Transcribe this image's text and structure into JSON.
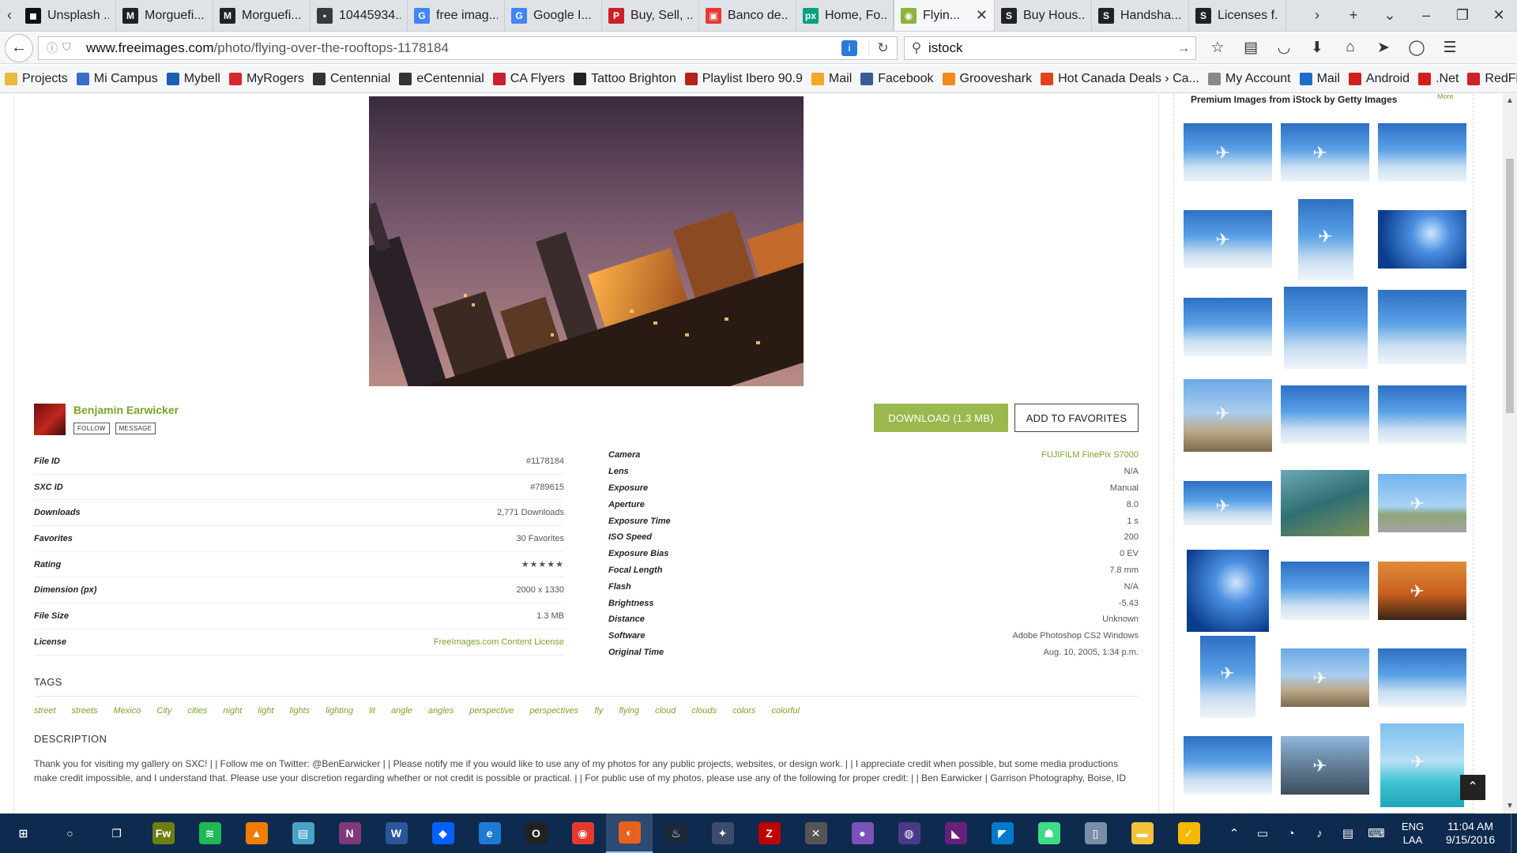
{
  "tabs": [
    {
      "label": "Unsplash ...",
      "icon": "unsplash-icon",
      "color": "#111111",
      "glyph": "◼"
    },
    {
      "label": "Morguefi...",
      "icon": "morguefile-icon",
      "color": "#222222",
      "glyph": "M"
    },
    {
      "label": "Morguefi...",
      "icon": "morguefile-icon",
      "color": "#222222",
      "glyph": "M"
    },
    {
      "label": "10445934...",
      "icon": "photo-icon",
      "color": "#3a3a3a",
      "glyph": "▪"
    },
    {
      "label": "free imag...",
      "icon": "google-icon",
      "color": "#4285f4",
      "glyph": "G"
    },
    {
      "label": "Google I...",
      "icon": "google-icon",
      "color": "#4285f4",
      "glyph": "G"
    },
    {
      "label": "Buy, Sell, ...",
      "icon": "pinterest-icon",
      "color": "#cb2027",
      "glyph": "P"
    },
    {
      "label": "Banco de...",
      "icon": "banco-icon",
      "color": "#e53935",
      "glyph": "▣"
    },
    {
      "label": "Home, Fo...",
      "icon": "pexels-icon",
      "color": "#05a081",
      "glyph": "px"
    },
    {
      "label": "Flyin...",
      "icon": "freeimages-icon",
      "color": "#8cb33e",
      "glyph": "◉",
      "active": true
    },
    {
      "label": "Buy Hous...",
      "icon": "istock-icon",
      "color": "#222222",
      "glyph": "S"
    },
    {
      "label": "Handsha...",
      "icon": "istock-icon",
      "color": "#222222",
      "glyph": "S"
    },
    {
      "label": "Licenses f...",
      "icon": "istock-icon",
      "color": "#222222",
      "glyph": "S"
    }
  ],
  "address": {
    "url_prefix": "www.freeimages.com",
    "url_path": "/photo/flying-over-the-rooftops-1178184"
  },
  "search": {
    "value": "istock"
  },
  "bookmarks": [
    {
      "label": "Projects",
      "color": "#e8b93a"
    },
    {
      "label": "Mi Campus",
      "color": "#3b6cc9"
    },
    {
      "label": "Mybell",
      "color": "#1a5fb4"
    },
    {
      "label": "MyRogers",
      "color": "#d7262b"
    },
    {
      "label": "Centennial",
      "color": "#333333"
    },
    {
      "label": "eCentennial",
      "color": "#333333"
    },
    {
      "label": "CA Flyers",
      "color": "#c8202d"
    },
    {
      "label": "Tattoo Brighton",
      "color": "#222222"
    },
    {
      "label": "Playlist Ibero 90.9",
      "color": "#b3221b"
    },
    {
      "label": "Mail",
      "color": "#f5a623"
    },
    {
      "label": "Facebook",
      "color": "#3b5998"
    },
    {
      "label": "Grooveshark",
      "color": "#f08a1c"
    },
    {
      "label": "Hot Canada Deals › Ca...",
      "color": "#e0431b"
    },
    {
      "label": "My Account",
      "color": "#888888"
    },
    {
      "label": "Mail",
      "color": "#1c6fc6"
    },
    {
      "label": "Android",
      "color": "#d01f1f"
    },
    {
      "label": ".Net",
      "color": "#d01f1f"
    },
    {
      "label": "RedFlagDeals",
      "color": "#d0202a"
    }
  ],
  "author": {
    "name": "Benjamin Earwicker",
    "follow_label": "FOLLOW",
    "message_label": "MESSAGE"
  },
  "actions": {
    "download_label": "DOWNLOAD (1.3 MB)",
    "favorites_label": "ADD TO FAVORITES"
  },
  "file_info": [
    {
      "key": "File ID",
      "value": "#1178184"
    },
    {
      "key": "SXC ID",
      "value": "#789615"
    },
    {
      "key": "Downloads",
      "value": "2,771 Downloads"
    },
    {
      "key": "Favorites",
      "value": "30 Favorites"
    },
    {
      "key": "Rating",
      "value": "★★★★★",
      "rating": 5
    },
    {
      "key": "Dimension (px)",
      "value": "2000 x 1330"
    },
    {
      "key": "File Size",
      "value": "1.3 MB"
    },
    {
      "key": "License",
      "value": "FreeImages.com Content License",
      "link": true
    }
  ],
  "camera_info": [
    {
      "key": "Camera",
      "value": "FUJIFILM FinePix S7000",
      "link": true
    },
    {
      "key": "Lens",
      "value": "N/A"
    },
    {
      "key": "Exposure",
      "value": "Manual"
    },
    {
      "key": "Aperture",
      "value": "8.0"
    },
    {
      "key": "Exposure Time",
      "value": "1 s"
    },
    {
      "key": "ISO Speed",
      "value": "200"
    },
    {
      "key": "Exposure Bias",
      "value": "0 EV"
    },
    {
      "key": "Focal Length",
      "value": "7.8 mm"
    },
    {
      "key": "Flash",
      "value": "N/A"
    },
    {
      "key": "Brightness",
      "value": "-5.43"
    },
    {
      "key": "Distance",
      "value": "Unknown"
    },
    {
      "key": "Software",
      "value": "Adobe Photoshop CS2 Windows"
    },
    {
      "key": "Original Time",
      "value": "Aug. 10, 2005, 1:34 p.m."
    }
  ],
  "tags_heading": "TAGS",
  "tags": [
    "street",
    "streets",
    "Mexico",
    "City",
    "cities",
    "night",
    "light",
    "lights",
    "lighting",
    "lit",
    "angle",
    "angles",
    "perspective",
    "perspectives",
    "fly",
    "flying",
    "cloud",
    "clouds",
    "colors",
    "colorful"
  ],
  "description_heading": "DESCRIPTION",
  "description": "Thank you for visiting my gallery on SXC! | | Follow me on Twitter: @BenEarwicker | | Please notify me if you would like to use any of my photos for any public projects, websites, or design work. | | I appreciate credit when possible, but some media productions make credit impossible, and I understand that. Please use your discretion regarding whether or not credit is possible or practical. | | For public use of my photos, please use any of the following for proper credit: | | Ben Earwicker | Garrison Photography, Boise, ID",
  "istock": {
    "title": "Premium Images from iStock by Getty Images",
    "more_label": "More"
  },
  "taskbar": {
    "apps": [
      {
        "name": "windows-start-icon",
        "glyph": "⊞",
        "color": "#0f2a4f"
      },
      {
        "name": "cortana-icon",
        "glyph": "○",
        "color": "#0f2a4f"
      },
      {
        "name": "task-view-icon",
        "glyph": "❐",
        "color": "#0f2a4f"
      },
      {
        "name": "fireworks-icon",
        "glyph": "Fw",
        "color": "#6e7f12"
      },
      {
        "name": "spotify-icon",
        "glyph": "≋",
        "color": "#1db954"
      },
      {
        "name": "vlc-icon",
        "glyph": "▲",
        "color": "#f07d00"
      },
      {
        "name": "notepad-icon",
        "glyph": "▤",
        "color": "#4aa3c7"
      },
      {
        "name": "onenote-icon",
        "glyph": "N",
        "color": "#80397b"
      },
      {
        "name": "word-icon",
        "glyph": "W",
        "color": "#2b579a"
      },
      {
        "name": "dropbox-icon",
        "glyph": "◆",
        "color": "#0061fe"
      },
      {
        "name": "edge-icon",
        "glyph": "e",
        "color": "#1e7bd3"
      },
      {
        "name": "opera-icon",
        "glyph": "O",
        "color": "#222222"
      },
      {
        "name": "chrome-icon",
        "glyph": "◉",
        "color": "#e6392e"
      },
      {
        "name": "firefox-icon",
        "glyph": "◐",
        "color": "#e8621b",
        "current": true
      },
      {
        "name": "steam-icon",
        "glyph": "♨",
        "color": "#1b2838"
      },
      {
        "name": "eclipse-icon",
        "glyph": "✦",
        "color": "#3c4c6d"
      },
      {
        "name": "filezilla-icon",
        "glyph": "Z",
        "color": "#bf0000"
      },
      {
        "name": "tools-icon",
        "glyph": "✕",
        "color": "#555555"
      },
      {
        "name": "aurora-icon",
        "glyph": "●",
        "color": "#7b52b8"
      },
      {
        "name": "globe-icon",
        "glyph": "◍",
        "color": "#4b3a8a"
      },
      {
        "name": "visual-studio-icon",
        "glyph": "◣",
        "color": "#68217a"
      },
      {
        "name": "vscode-icon",
        "glyph": "◤",
        "color": "#007acc"
      },
      {
        "name": "android-icon",
        "glyph": "☗",
        "color": "#3ddc84"
      },
      {
        "name": "file-icon",
        "glyph": "▯",
        "color": "#7a8fa6"
      },
      {
        "name": "file-explorer-icon",
        "glyph": "▬",
        "color": "#f3c13a"
      },
      {
        "name": "norton-icon",
        "glyph": "✓",
        "color": "#f6b900"
      }
    ],
    "lang_top": "ENG",
    "lang_bottom": "LAA",
    "time": "11:04 AM",
    "date": "9/15/2016"
  }
}
